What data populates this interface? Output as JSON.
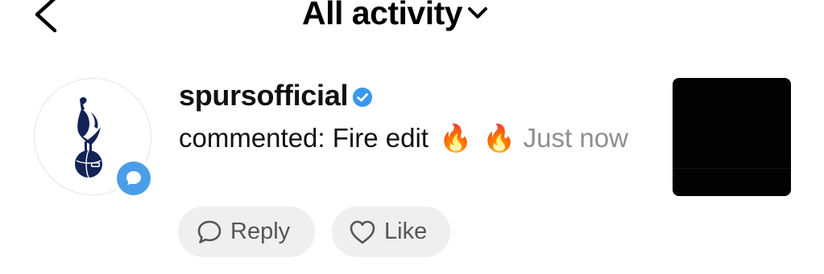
{
  "header": {
    "title": "All activity",
    "back_icon": "chevron-left-icon",
    "dropdown_icon": "chevron-down-icon"
  },
  "notification": {
    "username": "spursofficial",
    "verified_icon": "verified-badge-icon",
    "comment_prefix": "commented: Fire edit",
    "emoji_1": "🔥",
    "emoji_2": "🔥",
    "time": "Just now",
    "avatar_icon": "cockerel-crest-icon",
    "badge_icon": "comment-bubble-icon",
    "thumbnail_color": "#020202"
  },
  "actions": {
    "reply_label": "Reply",
    "reply_icon": "speech-bubble-icon",
    "like_label": "Like",
    "like_icon": "heart-outline-icon"
  },
  "colors": {
    "accent": "#4a9de8",
    "verified": "#3897f0",
    "muted_text": "#8e8e8e",
    "pill_bg": "#efefef"
  }
}
